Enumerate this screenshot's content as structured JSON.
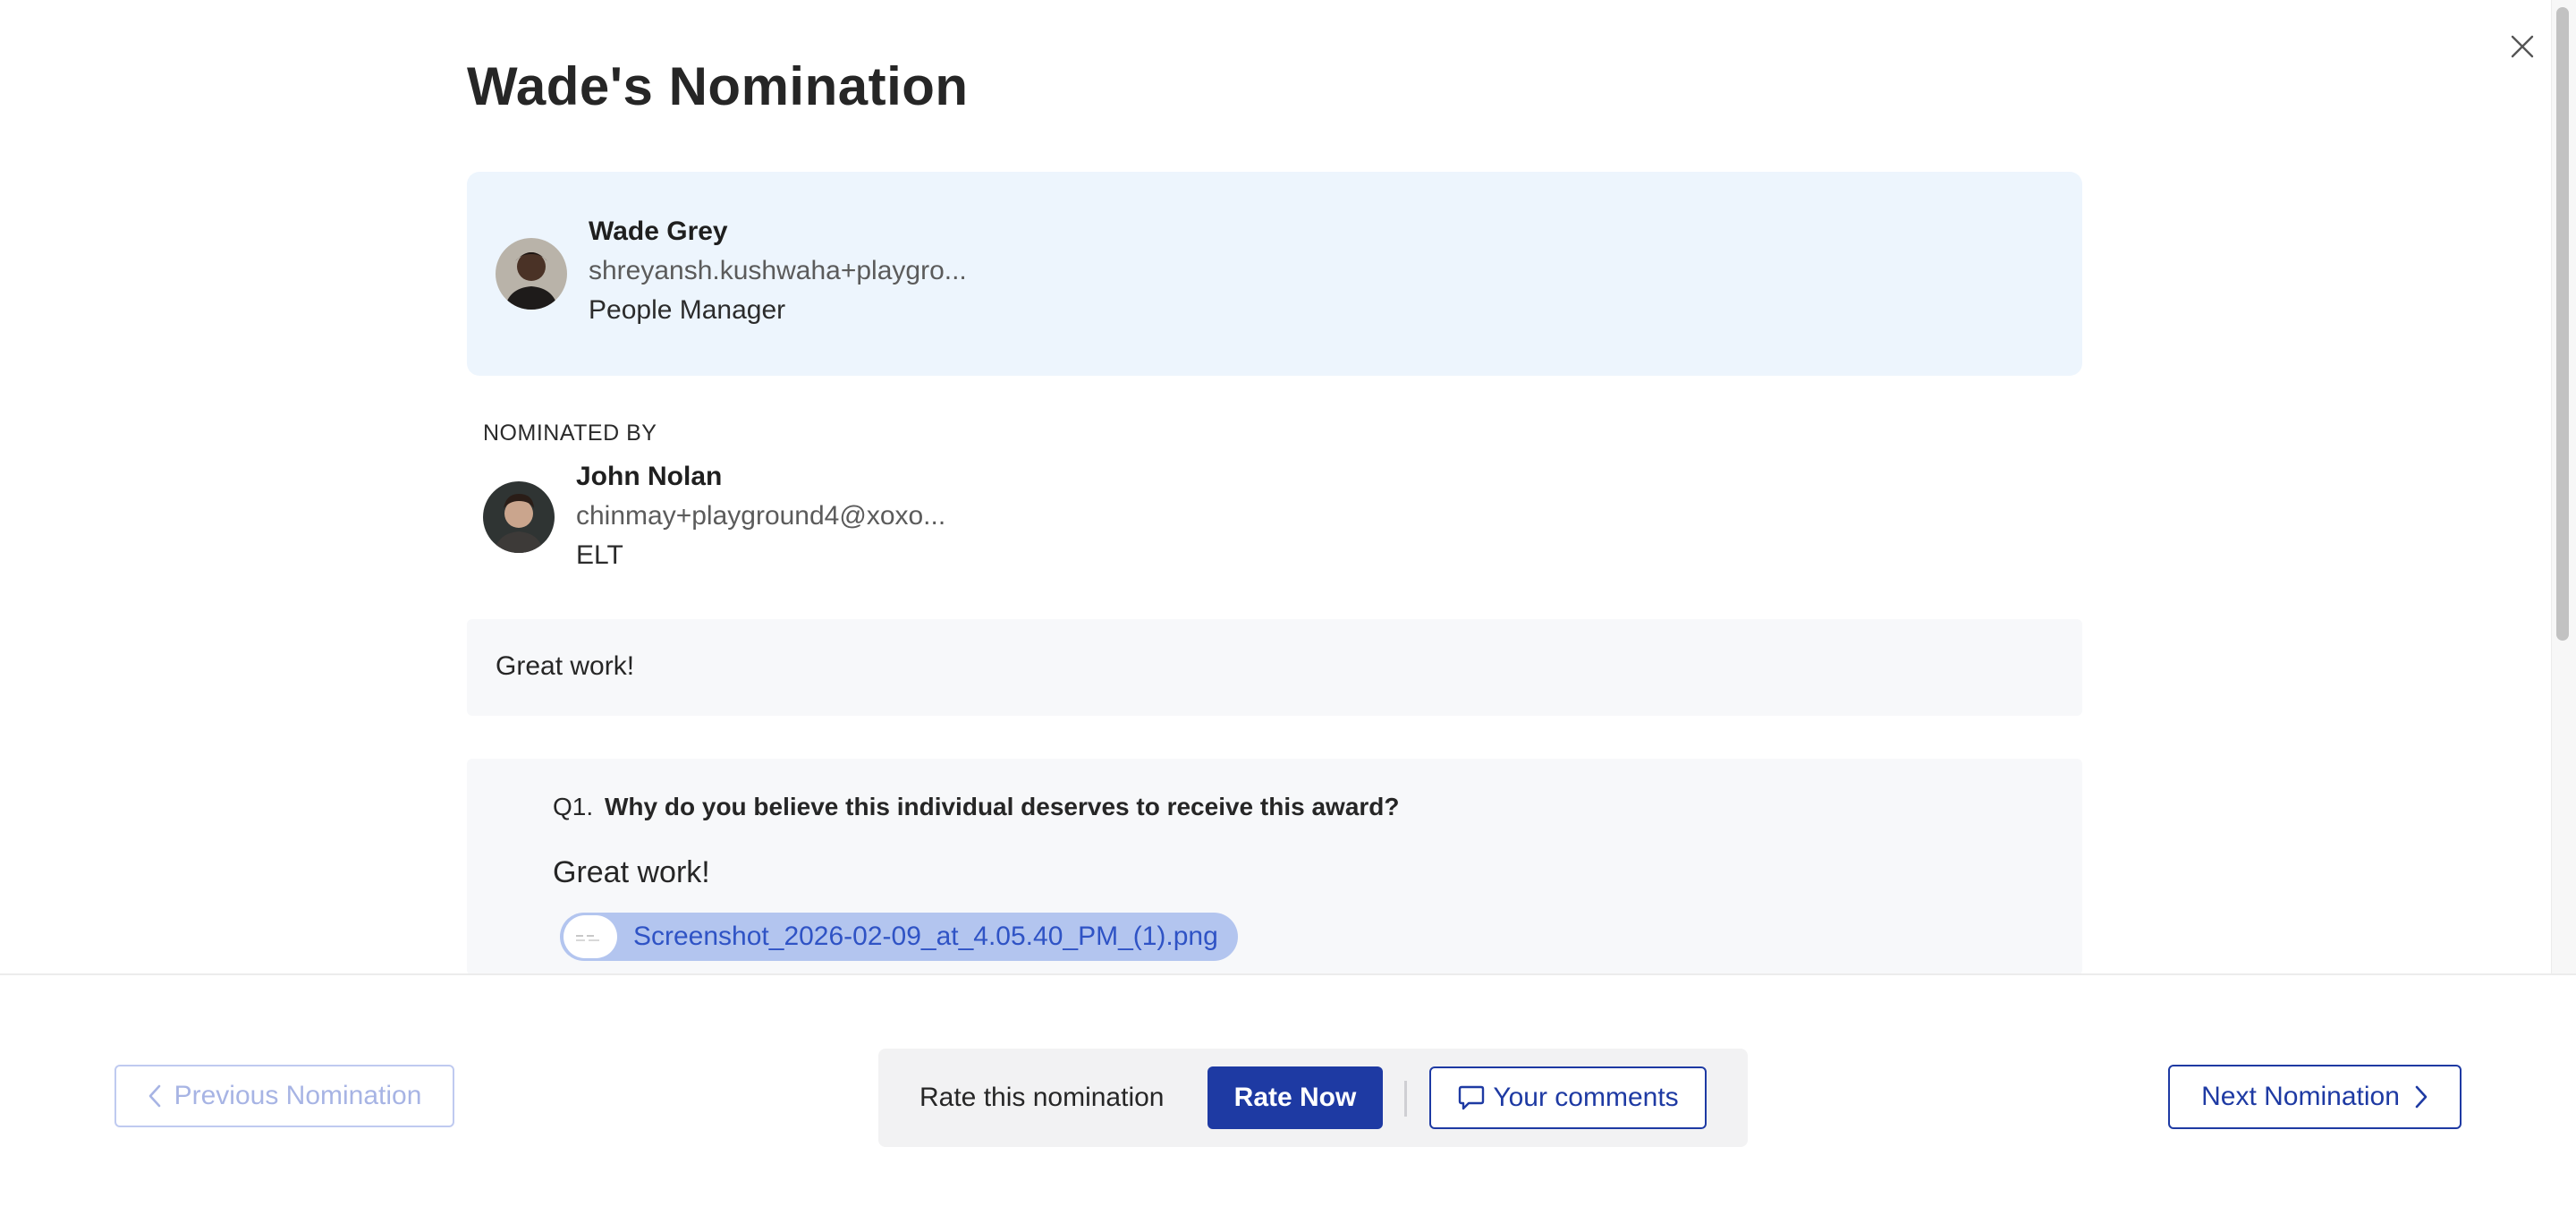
{
  "modal": {
    "title": "Wade's Nomination"
  },
  "nominee": {
    "name": "Wade Grey",
    "email": "shreyansh.kushwaha+playgro...",
    "role": "People Manager"
  },
  "nominated_by": {
    "label": "NOMINATED BY",
    "name": "John Nolan",
    "email": "chinmay+playground4@xoxo...",
    "role": "ELT"
  },
  "comment": {
    "text": "Great work!"
  },
  "question": {
    "number": "Q1.",
    "text": "Why do you believe this individual deserves to receive this award?",
    "answer": "Great work!",
    "attachment": "Screenshot_2026-02-09_at_4.05.40_PM_(1).png"
  },
  "footer": {
    "previous_label": "Previous Nomination",
    "rate_label": "Rate this nomination",
    "rate_now_label": "Rate Now",
    "comments_label": "Your comments",
    "next_label": "Next Nomination"
  },
  "icons": {
    "close": "close-icon",
    "chevron_left": "chevron-left-icon",
    "chevron_right": "chevron-right-icon",
    "comment": "comment-icon",
    "attachment_thumbnail": "image-thumbnail-icon"
  },
  "colors": {
    "primary": "#1e3aa3",
    "card_background": "#edf5fd",
    "section_background": "#f7f8fa",
    "attachment_chip": "#b3c5ef",
    "attachment_text": "#2f53c5"
  }
}
